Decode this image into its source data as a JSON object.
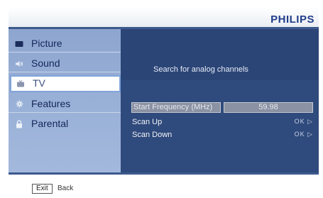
{
  "header": {
    "brand": "PHILIPS"
  },
  "sidebar": {
    "items": [
      {
        "label": "Picture",
        "icon": "monitor-icon",
        "active": false
      },
      {
        "label": "Sound",
        "icon": "speaker-icon",
        "active": false
      },
      {
        "label": "TV",
        "icon": "tv-icon",
        "active": true
      },
      {
        "label": "Features",
        "icon": "gear-icon",
        "active": false
      },
      {
        "label": "Parental",
        "icon": "lock-icon",
        "active": false
      }
    ]
  },
  "panel": {
    "title": "Search for analog channels",
    "start_frequency": {
      "label": "Start Frequency (MHz)",
      "value": "59.98"
    },
    "scan_up": {
      "label": "Scan Up",
      "arrow": "OK ▷"
    },
    "scan_down": {
      "label": "Scan Down",
      "arrow": "OK ▷"
    }
  },
  "footer": {
    "exit_key": "Exit",
    "back_label": "Back"
  },
  "colors": {
    "brand": "#1f3d8a",
    "sidebar_bg": "#9bb2d8",
    "panel_bg": "#2f4a7c",
    "active_border": "#7fa4d8"
  }
}
